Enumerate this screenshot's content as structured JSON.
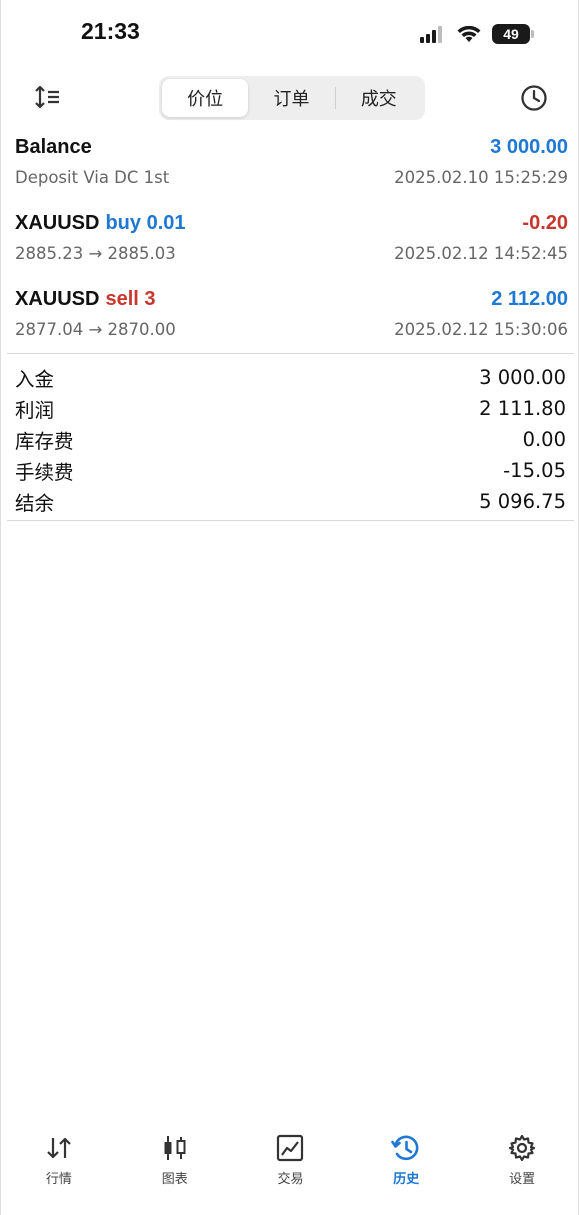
{
  "status_bar": {
    "time": "21:33",
    "battery": "49"
  },
  "toolbar": {
    "tabs": [
      {
        "label": "价位",
        "active": true
      },
      {
        "label": "订单",
        "active": false
      },
      {
        "label": "成交",
        "active": false
      }
    ],
    "sort_icon": "sort-lines-icon",
    "clock_icon": "clock-icon"
  },
  "deals": [
    {
      "symbol": "Balance",
      "side": "",
      "amount": "3 000.00",
      "amount_color": "#1f78d1",
      "subtitle": "Deposit Via DC 1st",
      "datetime": "2025.02.10 15:25:29"
    },
    {
      "symbol": "XAUUSD",
      "side": "buy 0.01",
      "side_color": "#1f78d1",
      "amount": "-0.20",
      "amount_color": "#c8372d",
      "subtitle": "2885.23 → 2885.03",
      "datetime": "2025.02.12 14:52:45"
    },
    {
      "symbol": "XAUUSD",
      "side": "sell 3",
      "side_color": "#c8372d",
      "amount": "2 112.00",
      "amount_color": "#1f78d1",
      "subtitle": "2877.04 → 2870.00",
      "datetime": "2025.02.12 15:30:06"
    }
  ],
  "summary": [
    {
      "label": "入金",
      "value": "3 000.00"
    },
    {
      "label": "利润",
      "value": "2 111.80"
    },
    {
      "label": "库存费",
      "value": "0.00"
    },
    {
      "label": "手续费",
      "value": "-15.05"
    },
    {
      "label": "结余",
      "value": "5 096.75"
    }
  ],
  "tabbar": [
    {
      "label": "行情",
      "icon": "quotes-arrows-icon",
      "active": false
    },
    {
      "label": "图表",
      "icon": "candlestick-chart-icon",
      "active": false
    },
    {
      "label": "交易",
      "icon": "trade-chart-icon",
      "active": false
    },
    {
      "label": "历史",
      "icon": "history-clock-icon",
      "active": true
    },
    {
      "label": "设置",
      "icon": "gear-icon",
      "active": false
    }
  ],
  "colors": {
    "accent": "#1f78d1",
    "negative": "#c8372d"
  }
}
